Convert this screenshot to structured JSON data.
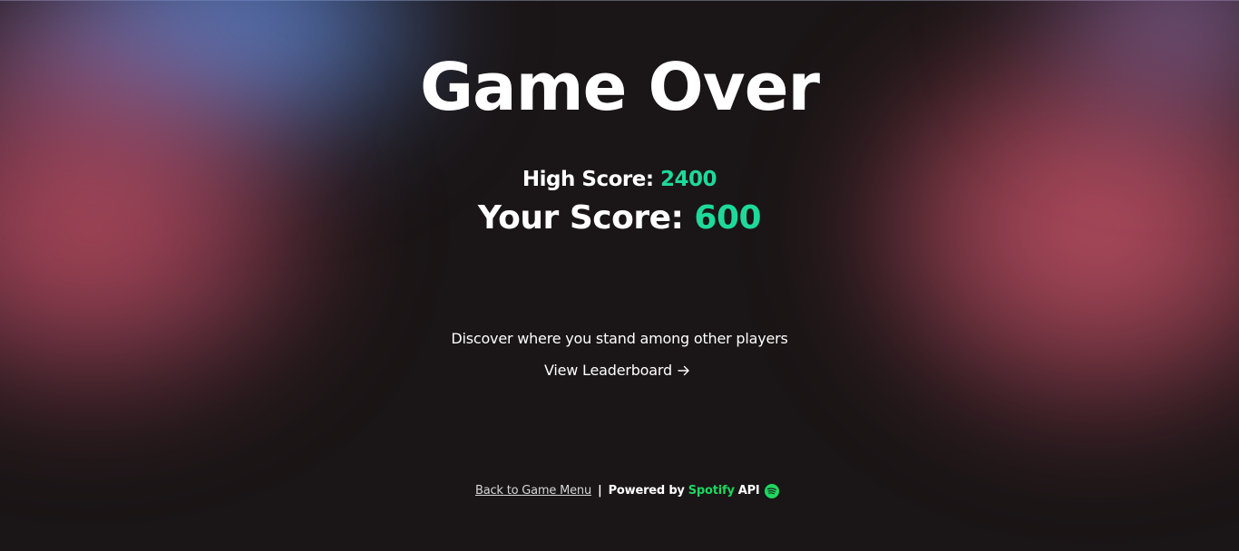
{
  "title": "Game Over",
  "scores": {
    "high_label": "High Score: ",
    "high_value": "2400",
    "your_label": "Your Score: ",
    "your_value": "600"
  },
  "leaderboard": {
    "prompt": "Discover where you stand among other players",
    "link_label": "View Leaderboard",
    "icon": "arrow-right-icon"
  },
  "footer": {
    "back_link": "Back to Game Menu",
    "separator": "|",
    "powered_by": "Powered by",
    "spotify": "Spotify",
    "api": "API",
    "icon": "spotify-icon"
  },
  "colors": {
    "background": "#1a1516",
    "accent_score": "#1ed99a",
    "spotify_green": "#1ed760",
    "glow_blue": "#6088d6",
    "glow_red": "#c4506a"
  }
}
